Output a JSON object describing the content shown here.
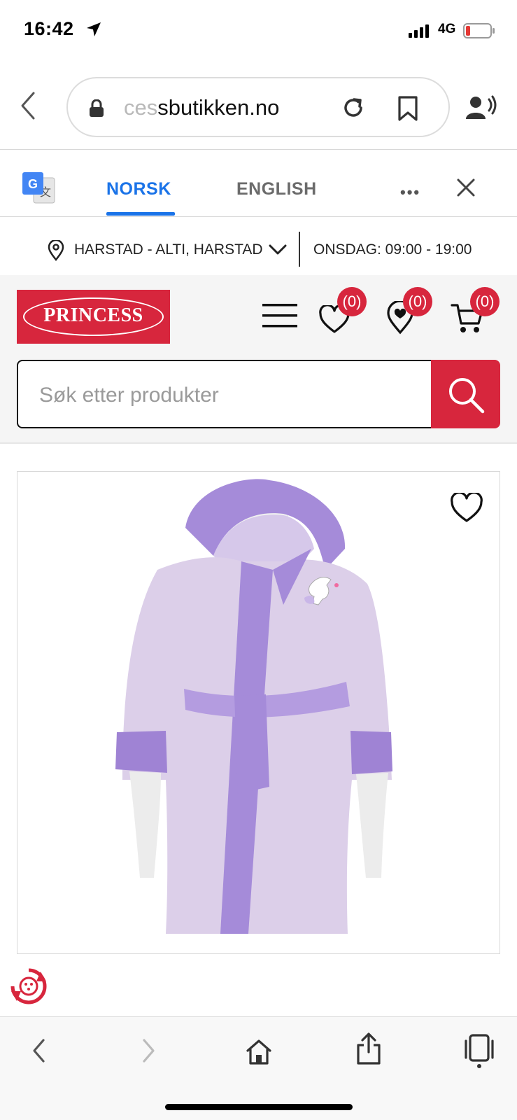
{
  "status_bar": {
    "time": "16:42",
    "network": "4G"
  },
  "browser": {
    "url_faded": "ces",
    "url_main": "sbutikken.no"
  },
  "translate": {
    "tab_active": "NORSK",
    "tab_other": "ENGLISH",
    "more": "•••"
  },
  "store": {
    "name": "HARSTAD - ALTI, HARSTAD",
    "hours": "ONSDAG: 09:00 - 19:00"
  },
  "header": {
    "logo_text": "PRINCESS",
    "wishlist_count": "(0)",
    "stores_count": "(0)",
    "cart_count": "(0)",
    "search_placeholder": "Søk etter produkter"
  },
  "colors": {
    "brand": "#d7263d",
    "translate_accent": "#1a73e8",
    "robe": "#d9cbe8",
    "robe_trim": "#9f83d4"
  },
  "icons": [
    "back-icon",
    "lock-icon",
    "reload-icon",
    "bookmark-icon",
    "reader-voice-icon",
    "google-translate-icon",
    "close-icon",
    "location-pin-icon",
    "chevron-down-icon",
    "menu-icon",
    "heart-icon",
    "map-pin-heart-icon",
    "cart-icon",
    "search-icon",
    "favorite-icon",
    "recycle-icon",
    "forward-icon",
    "home-icon",
    "share-icon",
    "tabs-icon"
  ]
}
